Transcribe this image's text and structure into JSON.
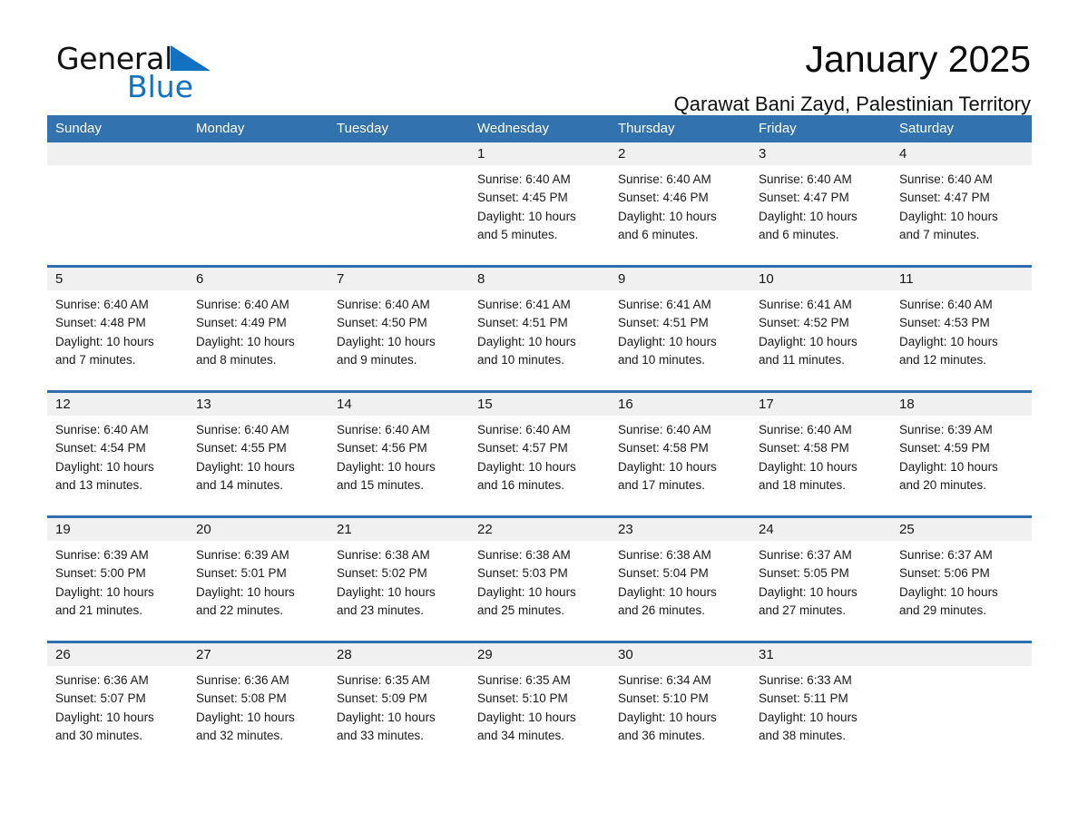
{
  "brand": {
    "name_part1": "General",
    "name_part2": "Blue",
    "accent_color": "#1271c0",
    "triangle_icon": "brand-triangle-icon"
  },
  "header": {
    "title": "January 2025",
    "subtitle": "Qarawat Bani Zayd, Palestinian Territory"
  },
  "colors": {
    "header_blue": "#3272ae",
    "row_divider_blue": "#2f6fad",
    "daynum_band": "#f0f0f0",
    "text": "#1a1a1a"
  },
  "weekdays": [
    "Sunday",
    "Monday",
    "Tuesday",
    "Wednesday",
    "Thursday",
    "Friday",
    "Saturday"
  ],
  "weeks": [
    [
      {
        "day": "",
        "sunrise": "",
        "sunset": "",
        "daylight1": "",
        "daylight2": ""
      },
      {
        "day": "",
        "sunrise": "",
        "sunset": "",
        "daylight1": "",
        "daylight2": ""
      },
      {
        "day": "",
        "sunrise": "",
        "sunset": "",
        "daylight1": "",
        "daylight2": ""
      },
      {
        "day": "1",
        "sunrise": "Sunrise: 6:40 AM",
        "sunset": "Sunset: 4:45 PM",
        "daylight1": "Daylight: 10 hours",
        "daylight2": "and 5 minutes."
      },
      {
        "day": "2",
        "sunrise": "Sunrise: 6:40 AM",
        "sunset": "Sunset: 4:46 PM",
        "daylight1": "Daylight: 10 hours",
        "daylight2": "and 6 minutes."
      },
      {
        "day": "3",
        "sunrise": "Sunrise: 6:40 AM",
        "sunset": "Sunset: 4:47 PM",
        "daylight1": "Daylight: 10 hours",
        "daylight2": "and 6 minutes."
      },
      {
        "day": "4",
        "sunrise": "Sunrise: 6:40 AM",
        "sunset": "Sunset: 4:47 PM",
        "daylight1": "Daylight: 10 hours",
        "daylight2": "and 7 minutes."
      }
    ],
    [
      {
        "day": "5",
        "sunrise": "Sunrise: 6:40 AM",
        "sunset": "Sunset: 4:48 PM",
        "daylight1": "Daylight: 10 hours",
        "daylight2": "and 7 minutes."
      },
      {
        "day": "6",
        "sunrise": "Sunrise: 6:40 AM",
        "sunset": "Sunset: 4:49 PM",
        "daylight1": "Daylight: 10 hours",
        "daylight2": "and 8 minutes."
      },
      {
        "day": "7",
        "sunrise": "Sunrise: 6:40 AM",
        "sunset": "Sunset: 4:50 PM",
        "daylight1": "Daylight: 10 hours",
        "daylight2": "and 9 minutes."
      },
      {
        "day": "8",
        "sunrise": "Sunrise: 6:41 AM",
        "sunset": "Sunset: 4:51 PM",
        "daylight1": "Daylight: 10 hours",
        "daylight2": "and 10 minutes."
      },
      {
        "day": "9",
        "sunrise": "Sunrise: 6:41 AM",
        "sunset": "Sunset: 4:51 PM",
        "daylight1": "Daylight: 10 hours",
        "daylight2": "and 10 minutes."
      },
      {
        "day": "10",
        "sunrise": "Sunrise: 6:41 AM",
        "sunset": "Sunset: 4:52 PM",
        "daylight1": "Daylight: 10 hours",
        "daylight2": "and 11 minutes."
      },
      {
        "day": "11",
        "sunrise": "Sunrise: 6:40 AM",
        "sunset": "Sunset: 4:53 PM",
        "daylight1": "Daylight: 10 hours",
        "daylight2": "and 12 minutes."
      }
    ],
    [
      {
        "day": "12",
        "sunrise": "Sunrise: 6:40 AM",
        "sunset": "Sunset: 4:54 PM",
        "daylight1": "Daylight: 10 hours",
        "daylight2": "and 13 minutes."
      },
      {
        "day": "13",
        "sunrise": "Sunrise: 6:40 AM",
        "sunset": "Sunset: 4:55 PM",
        "daylight1": "Daylight: 10 hours",
        "daylight2": "and 14 minutes."
      },
      {
        "day": "14",
        "sunrise": "Sunrise: 6:40 AM",
        "sunset": "Sunset: 4:56 PM",
        "daylight1": "Daylight: 10 hours",
        "daylight2": "and 15 minutes."
      },
      {
        "day": "15",
        "sunrise": "Sunrise: 6:40 AM",
        "sunset": "Sunset: 4:57 PM",
        "daylight1": "Daylight: 10 hours",
        "daylight2": "and 16 minutes."
      },
      {
        "day": "16",
        "sunrise": "Sunrise: 6:40 AM",
        "sunset": "Sunset: 4:58 PM",
        "daylight1": "Daylight: 10 hours",
        "daylight2": "and 17 minutes."
      },
      {
        "day": "17",
        "sunrise": "Sunrise: 6:40 AM",
        "sunset": "Sunset: 4:58 PM",
        "daylight1": "Daylight: 10 hours",
        "daylight2": "and 18 minutes."
      },
      {
        "day": "18",
        "sunrise": "Sunrise: 6:39 AM",
        "sunset": "Sunset: 4:59 PM",
        "daylight1": "Daylight: 10 hours",
        "daylight2": "and 20 minutes."
      }
    ],
    [
      {
        "day": "19",
        "sunrise": "Sunrise: 6:39 AM",
        "sunset": "Sunset: 5:00 PM",
        "daylight1": "Daylight: 10 hours",
        "daylight2": "and 21 minutes."
      },
      {
        "day": "20",
        "sunrise": "Sunrise: 6:39 AM",
        "sunset": "Sunset: 5:01 PM",
        "daylight1": "Daylight: 10 hours",
        "daylight2": "and 22 minutes."
      },
      {
        "day": "21",
        "sunrise": "Sunrise: 6:38 AM",
        "sunset": "Sunset: 5:02 PM",
        "daylight1": "Daylight: 10 hours",
        "daylight2": "and 23 minutes."
      },
      {
        "day": "22",
        "sunrise": "Sunrise: 6:38 AM",
        "sunset": "Sunset: 5:03 PM",
        "daylight1": "Daylight: 10 hours",
        "daylight2": "and 25 minutes."
      },
      {
        "day": "23",
        "sunrise": "Sunrise: 6:38 AM",
        "sunset": "Sunset: 5:04 PM",
        "daylight1": "Daylight: 10 hours",
        "daylight2": "and 26 minutes."
      },
      {
        "day": "24",
        "sunrise": "Sunrise: 6:37 AM",
        "sunset": "Sunset: 5:05 PM",
        "daylight1": "Daylight: 10 hours",
        "daylight2": "and 27 minutes."
      },
      {
        "day": "25",
        "sunrise": "Sunrise: 6:37 AM",
        "sunset": "Sunset: 5:06 PM",
        "daylight1": "Daylight: 10 hours",
        "daylight2": "and 29 minutes."
      }
    ],
    [
      {
        "day": "26",
        "sunrise": "Sunrise: 6:36 AM",
        "sunset": "Sunset: 5:07 PM",
        "daylight1": "Daylight: 10 hours",
        "daylight2": "and 30 minutes."
      },
      {
        "day": "27",
        "sunrise": "Sunrise: 6:36 AM",
        "sunset": "Sunset: 5:08 PM",
        "daylight1": "Daylight: 10 hours",
        "daylight2": "and 32 minutes."
      },
      {
        "day": "28",
        "sunrise": "Sunrise: 6:35 AM",
        "sunset": "Sunset: 5:09 PM",
        "daylight1": "Daylight: 10 hours",
        "daylight2": "and 33 minutes."
      },
      {
        "day": "29",
        "sunrise": "Sunrise: 6:35 AM",
        "sunset": "Sunset: 5:10 PM",
        "daylight1": "Daylight: 10 hours",
        "daylight2": "and 34 minutes."
      },
      {
        "day": "30",
        "sunrise": "Sunrise: 6:34 AM",
        "sunset": "Sunset: 5:10 PM",
        "daylight1": "Daylight: 10 hours",
        "daylight2": "and 36 minutes."
      },
      {
        "day": "31",
        "sunrise": "Sunrise: 6:33 AM",
        "sunset": "Sunset: 5:11 PM",
        "daylight1": "Daylight: 10 hours",
        "daylight2": "and 38 minutes."
      },
      {
        "day": "",
        "sunrise": "",
        "sunset": "",
        "daylight1": "",
        "daylight2": ""
      }
    ]
  ]
}
